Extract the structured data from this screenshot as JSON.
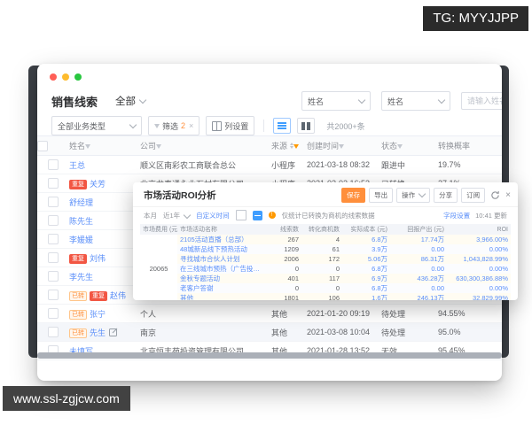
{
  "watermarks": {
    "tg_badge": "TG: MYYJJPP",
    "site_badge": "www.ssl-zgjcw.com"
  },
  "colors": {
    "accent_blue": "#409eff",
    "link_blue": "#5b8ff9",
    "accent_orange": "#ff8f3c",
    "badge_red": "#f25643",
    "funnel_orange": "#ff9900"
  },
  "icons": {
    "traffic_red": "#ff5f57",
    "traffic_yellow": "#febc2e",
    "traffic_green": "#29c740",
    "filter": "funnel",
    "column_settings": "columns",
    "list_view": "bars",
    "kanban_view": "columns",
    "edit": "pencil-square",
    "refresh": "circular-arrow",
    "close": "×",
    "warning": "!"
  },
  "window": {
    "title": "销售线索",
    "scope": "全部",
    "search": {
      "field1": "姓名",
      "field2": "姓名",
      "input_placeholder": "请输入姓名"
    },
    "filters": {
      "type_select": "全部业务类型",
      "filter_label": "筛选",
      "filter_count": "2",
      "clear_x": "×",
      "column_settings": "列设置",
      "total_count": "共2000+条"
    },
    "table": {
      "headers": [
        "姓名",
        "公司",
        "来源",
        "创建时间",
        "状态",
        "转换概率"
      ],
      "rows": [
        {
          "name": "王总",
          "company": "顺义区南彩农工商联合总公",
          "source": "小程序",
          "created": "2021-03-18 08:32",
          "status": "跟进中",
          "prob": "19.7%"
        },
        {
          "badge1": "重复",
          "name": "关芳",
          "company": "北京龙泰通永业石材有限公司",
          "source": "小程序",
          "created": "2021-02-02 16:53",
          "status": "已转换",
          "prob": "27.1%"
        },
        {
          "name": "舒经理",
          "company": "",
          "source": "",
          "created": "",
          "status": "",
          "prob": ""
        },
        {
          "name": "陈先生",
          "company": "",
          "source": "",
          "created": "",
          "status": "",
          "prob": ""
        },
        {
          "name": "李媛媛",
          "company": "",
          "source": "",
          "created": "",
          "status": "",
          "prob": ""
        },
        {
          "badge1": "重复",
          "name": "刘伟",
          "company": "",
          "source": "",
          "created": "",
          "status": "",
          "prob": ""
        },
        {
          "name": "李先生",
          "company": "",
          "source": "",
          "created": "",
          "status": "",
          "prob": ""
        },
        {
          "badge1": "已转",
          "badge2": "重复",
          "name": "赵伟",
          "company": "",
          "source": "",
          "created": "",
          "status": "",
          "prob": ""
        },
        {
          "badge1": "已转",
          "name": "张宁",
          "company": "个人",
          "source": "其他",
          "created": "2021-01-20 09:19",
          "status": "待处理",
          "prob": "94.55%"
        },
        {
          "badge1": "已转",
          "name": "先生",
          "company": "南京",
          "source": "其他",
          "created": "2021-03-08 10:04",
          "status": "待处理",
          "prob": "95.0%"
        },
        {
          "name": "未填写",
          "company": "北京恒丰苑投资管理有限公司",
          "source": "其他",
          "created": "2021-01-28 13:52",
          "status": "无效",
          "prob": "95.45%"
        }
      ]
    }
  },
  "roi": {
    "title": "市场活动ROI分析",
    "buttons": {
      "b1": "保存",
      "b2": "导出",
      "b3": "操作",
      "b4": "分享",
      "b5": "订阅",
      "close": "×"
    },
    "tools": {
      "period": "本月",
      "range": "近1年",
      "custom": "自定义时间",
      "note": "仅统计已转换为商机的线索数据",
      "settings": "字段设置",
      "updated": "10:41 更新"
    },
    "table": {
      "headers": [
        "市场费用 (元)",
        "市场活动名称",
        "线索数",
        "转化商机数",
        "实际成本 (元)",
        "回报产出 (元)",
        "ROI"
      ],
      "cost_total": "20065",
      "rows": [
        {
          "name": "2105活动直播（总部）",
          "leads": "267",
          "opps": "4",
          "cost": "6.8万",
          "output": "17.74万",
          "roi": "3,966.00%"
        },
        {
          "name": "48城新品线下预热活动",
          "leads": "1209",
          "opps": "61",
          "cost": "3.9万",
          "output": "0.00",
          "roi": "0.00%"
        },
        {
          "name": "寻找城市合伙人计划",
          "leads": "2006",
          "opps": "172",
          "cost": "5.06万",
          "output": "86.31万",
          "roi": "1,043,828.99%"
        },
        {
          "name": "在三线城市预热（广告投放）",
          "leads": "0",
          "opps": "0",
          "cost": "6.8万",
          "output": "0.00",
          "roi": "0.00%"
        },
        {
          "name": "金秋专题活动",
          "leads": "401",
          "opps": "117",
          "cost": "6.9万",
          "output": "436.28万",
          "roi": "630,300,386.88%"
        },
        {
          "name": "老客户答谢",
          "leads": "0",
          "opps": "0",
          "cost": "6.8万",
          "output": "0.00",
          "roi": "0.00%"
        },
        {
          "name": "其他",
          "leads": "1801",
          "opps": "106",
          "cost": "1.6万",
          "output": "246.13万",
          "roi": "32,829.99%"
        }
      ]
    }
  }
}
